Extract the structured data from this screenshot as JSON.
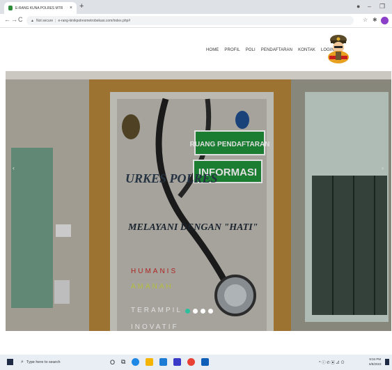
{
  "browser": {
    "tab_title": "E-RANG KUNA POLRES MTR",
    "tab_close": "×",
    "new_tab": "+",
    "window_controls": {
      "minimize": "–",
      "maximize": "❐"
    },
    "nav": {
      "back": "←",
      "forward": "→",
      "reload": "C"
    },
    "url_security": "Not secure",
    "url": "e-rang-kinikpolresmetrobekasi.com/index.php#",
    "star": "☆",
    "extensions": "✱",
    "profile_color": "#8b3fc9"
  },
  "site": {
    "menu": [
      "HOME",
      "PROFIL",
      "POLI",
      "PENDAFTARAN",
      "KONTAK",
      "LOGIN"
    ]
  },
  "hero": {
    "signs": {
      "ruang": "RUANG PENDAFTARAN",
      "informasi": "INFORMASI",
      "urkes": "URKES POLRES",
      "melayani": "MELAYANI DENGAN \"HATI\"",
      "humanis": "HUMANIS",
      "amanah": "AMANAH",
      "terampil": "TERAMPIL",
      "inovatif": "INOVATIF"
    },
    "prev_arrow": "‹",
    "next_arrow": "›",
    "slides_count": 4,
    "active_slide": 1,
    "accent_color": "#2bbf9b"
  },
  "taskbar": {
    "search_placeholder": "Type here to search",
    "tray_text": "^ ⓘ ✆ ▣ ⊿ ⊙",
    "time": "9:04 PM",
    "date": "6/8/2023"
  }
}
